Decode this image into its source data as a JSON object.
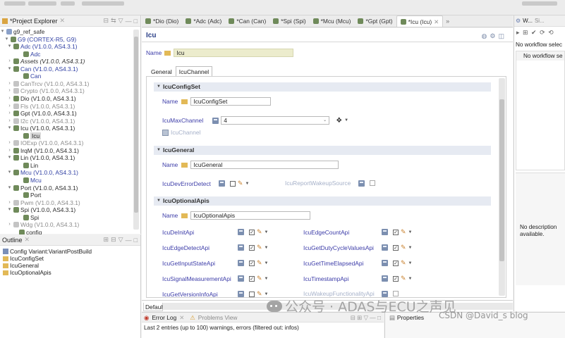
{
  "project_explorer": {
    "title": "*Project Explorer",
    "items": [
      {
        "label": "g9_ref_safe",
        "style": "dark"
      },
      {
        "label": "G9 (CORTEX-R5, G9)",
        "style": "blue"
      },
      {
        "label": "Adc (V1.0.0, AS4.3.1)",
        "style": "blue"
      },
      {
        "label": "Adc",
        "style": "blue"
      },
      {
        "label": "Assets (V1.0.0, AS4.3.1)",
        "style": "italic"
      },
      {
        "label": "Can (V1.0.0, AS4.3.1)",
        "style": "blue"
      },
      {
        "label": "Can",
        "style": "blue"
      },
      {
        "label": "CanTrcv (V1.0.0, AS4.3.1)",
        "style": "gray"
      },
      {
        "label": "Crypto (V1.0.0, AS4.3.1)",
        "style": "gray"
      },
      {
        "label": "Dio (V1.0.0, AS4.3.1)",
        "style": "dark"
      },
      {
        "label": "Fls (V1.0.0, AS4.3.1)",
        "style": "gray"
      },
      {
        "label": "Gpt (V1.0.0, AS4.3.1)",
        "style": "dark"
      },
      {
        "label": "I2c (V1.0.0, AS4.3.1)",
        "style": "gray"
      },
      {
        "label": "Icu (V1.0.0, AS4.3.1)",
        "style": "dark"
      },
      {
        "label": "Icu",
        "style": "selected"
      },
      {
        "label": "IOExp (V1.0.0, AS4.3.1)",
        "style": "gray"
      },
      {
        "label": "IrqM (V1.0.0, AS4.3.1)",
        "style": "dark"
      },
      {
        "label": "Lin (V1.0.0, AS4.3.1)",
        "style": "dark"
      },
      {
        "label": "Lin",
        "style": "dark"
      },
      {
        "label": "Mcu (V1.0.0, AS4.3.1)",
        "style": "blue"
      },
      {
        "label": "Mcu",
        "style": "blue"
      },
      {
        "label": "Port (V1.0.0, AS4.3.1)",
        "style": "dark"
      },
      {
        "label": "Port",
        "style": "dark"
      },
      {
        "label": "Pwm (V1.0.0, AS4.3.1)",
        "style": "gray"
      },
      {
        "label": "Spi (V1.0.0, AS4.3.1)",
        "style": "dark"
      },
      {
        "label": "Spi",
        "style": "dark"
      },
      {
        "label": "Wdg (V1.0.0, AS4.3.1)",
        "style": "gray"
      },
      {
        "label": "config",
        "style": "dark"
      }
    ]
  },
  "outline": {
    "title": "Outline",
    "items": [
      "Config Variant:VariantPostBuild",
      "IcuConfigSet",
      "IcuGeneral",
      "IcuOptionalApis"
    ]
  },
  "editor_tabs": [
    "*Dio (Dio)",
    "*Adc (Adc)",
    "*Can (Can)",
    "*Spi (Spi)",
    "*Mcu (Mcu)",
    "*Gpt (Gpt)",
    "*Icu (Icu)"
  ],
  "editor": {
    "title": "Icu",
    "name_label": "Name",
    "name_value": "Icu",
    "subtabs": [
      "General",
      "IcuChannel"
    ],
    "bottom_tab": "Default",
    "config_set": {
      "header": "IcuConfigSet",
      "name_label": "Name",
      "name_value": "IcuConfigSet",
      "max_channel_label": "IcuMaxChannel",
      "max_channel_value": "4",
      "channel_label": "IcuChannel"
    },
    "general": {
      "header": "IcuGeneral",
      "name_label": "Name",
      "name_value": "IcuGeneral",
      "dev_error_detect": "IcuDevErrorDetect",
      "report_wakeup": "IcuReportWakeupSource"
    },
    "optional_apis": {
      "header": "IcuOptionalApis",
      "name_label": "Name",
      "name_value": "IcuOptionalApis",
      "left": [
        {
          "label": "IcuDeInitApi",
          "checked": true
        },
        {
          "label": "IcuEdgeDetectApi",
          "checked": true
        },
        {
          "label": "IcuGetInputStateApi",
          "checked": true
        },
        {
          "label": "IcuSignalMeasurementApi",
          "checked": true
        },
        {
          "label": "IcuGetVersionInfoApi",
          "checked": false
        }
      ],
      "right": [
        {
          "label": "IcuEdgeCountApi",
          "checked": true,
          "enabled": true
        },
        {
          "label": "IcuGetDutyCycleValuesApi",
          "checked": true,
          "enabled": true
        },
        {
          "label": "IcuGetTimeElapsedApi",
          "checked": true,
          "enabled": true
        },
        {
          "label": "IcuTimestampApi",
          "checked": true,
          "enabled": true
        },
        {
          "label": "IcuWakeupFunctionalityApi",
          "checked": false,
          "enabled": false
        }
      ]
    }
  },
  "bottom": {
    "error_log_tab": "Error Log",
    "problems_tab": "Problems View",
    "status": "Last 2 entries (up to 100) warnings, errors (filtered out: infos)",
    "properties_tab": "Properties"
  },
  "right_panel": {
    "tabs": [
      "W...",
      "Si..."
    ],
    "no_workflow_1": "No workflow selec",
    "no_workflow_2": "No workflow se",
    "no_description": "No description available."
  },
  "watermark": {
    "text": "公众号 · ADAS与ECU之声见",
    "csdn": "CSDN @David_s blog"
  }
}
